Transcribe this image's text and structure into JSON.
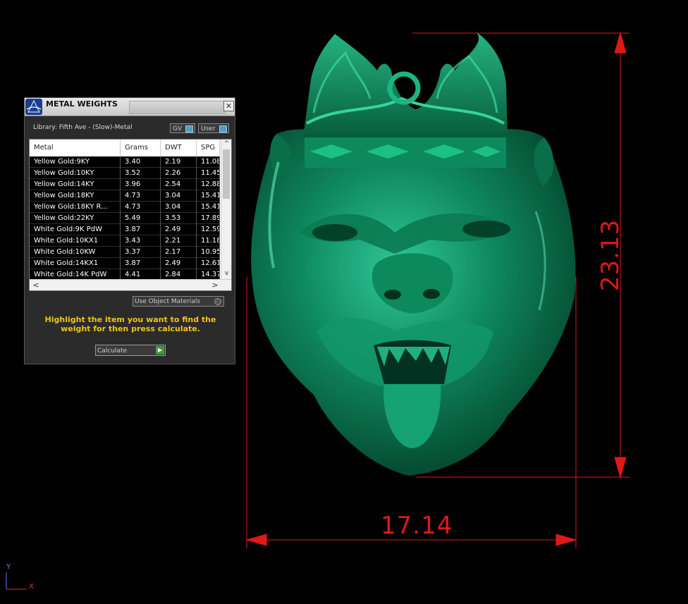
{
  "viewport": {
    "dimension_width": "17.14",
    "dimension_height": "23.13",
    "axis_y": "Y",
    "axis_x": "X",
    "dimension_color": "#e01818",
    "model_color": "#0e8a5f"
  },
  "panel": {
    "title": "METAL WEIGHTS",
    "close_glyph": "✕",
    "library_label": "Library: Fifth Ave - (Slow)-Metal",
    "gv_toggle": "GV",
    "user_toggle": "User",
    "columns": [
      "Metal",
      "Grams",
      "DWT",
      "SPG"
    ],
    "rows": [
      {
        "metal": "Yellow Gold:9KY",
        "grams": "3.40",
        "dwt": "2.19",
        "spg": "11.08"
      },
      {
        "metal": "Yellow Gold:10KY",
        "grams": "3.52",
        "dwt": "2.26",
        "spg": "11.45"
      },
      {
        "metal": "Yellow Gold:14KY",
        "grams": "3.96",
        "dwt": "2.54",
        "spg": "12.88"
      },
      {
        "metal": "Yellow Gold:18KY",
        "grams": "4.73",
        "dwt": "3.04",
        "spg": "15.41"
      },
      {
        "metal": "Yellow Gold:18KY R...",
        "grams": "4.73",
        "dwt": "3.04",
        "spg": "15.41"
      },
      {
        "metal": "Yellow Gold:22KY",
        "grams": "5.49",
        "dwt": "3.53",
        "spg": "17.89"
      },
      {
        "metal": "White Gold:9K PdW",
        "grams": "3.87",
        "dwt": "2.49",
        "spg": "12.59"
      },
      {
        "metal": "White Gold:10KX1",
        "grams": "3.43",
        "dwt": "2.21",
        "spg": "11.18"
      },
      {
        "metal": "White Gold:10KW",
        "grams": "3.37",
        "dwt": "2.17",
        "spg": "10.95"
      },
      {
        "metal": "White Gold:14KX1",
        "grams": "3.87",
        "dwt": "2.49",
        "spg": "12.61"
      },
      {
        "metal": "White Gold:14K PdW",
        "grams": "4.41",
        "dwt": "2.84",
        "spg": "14.37"
      }
    ],
    "use_object_materials": "Use Object Materials",
    "instruction": "Highlight the item you want to find the weight for then press calculate.",
    "calculate_button": "Calculate"
  }
}
